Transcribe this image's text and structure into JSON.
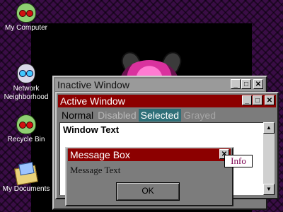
{
  "desktop": {
    "icons": [
      {
        "label": "My Computer",
        "icon": "zim-icon"
      },
      {
        "label": "Network Neighborhood",
        "icon": "gir-icon"
      },
      {
        "label": "Recycle Bin",
        "icon": "zim-icon"
      },
      {
        "label": "My Documents",
        "icon": "folder-icon"
      }
    ]
  },
  "inactive_window": {
    "title": "Inactive Window"
  },
  "active_window": {
    "title": "Active Window",
    "menu": {
      "normal": "Normal",
      "disabled": "Disabled",
      "selected": "Selected",
      "grayed": "Grayed"
    },
    "window_text": "Window Text"
  },
  "message_box": {
    "title": "Message Box",
    "text": "Message Text",
    "ok_label": "OK"
  },
  "tooltip": {
    "text": "Info"
  },
  "title_buttons": {
    "minimize": "_",
    "maximize": "□",
    "close": "✕"
  },
  "colors": {
    "active_title": "#8c0000",
    "inactive_title": "#9a9a9a",
    "selection": "#2e6f78",
    "desktop": "#3a0d46"
  }
}
